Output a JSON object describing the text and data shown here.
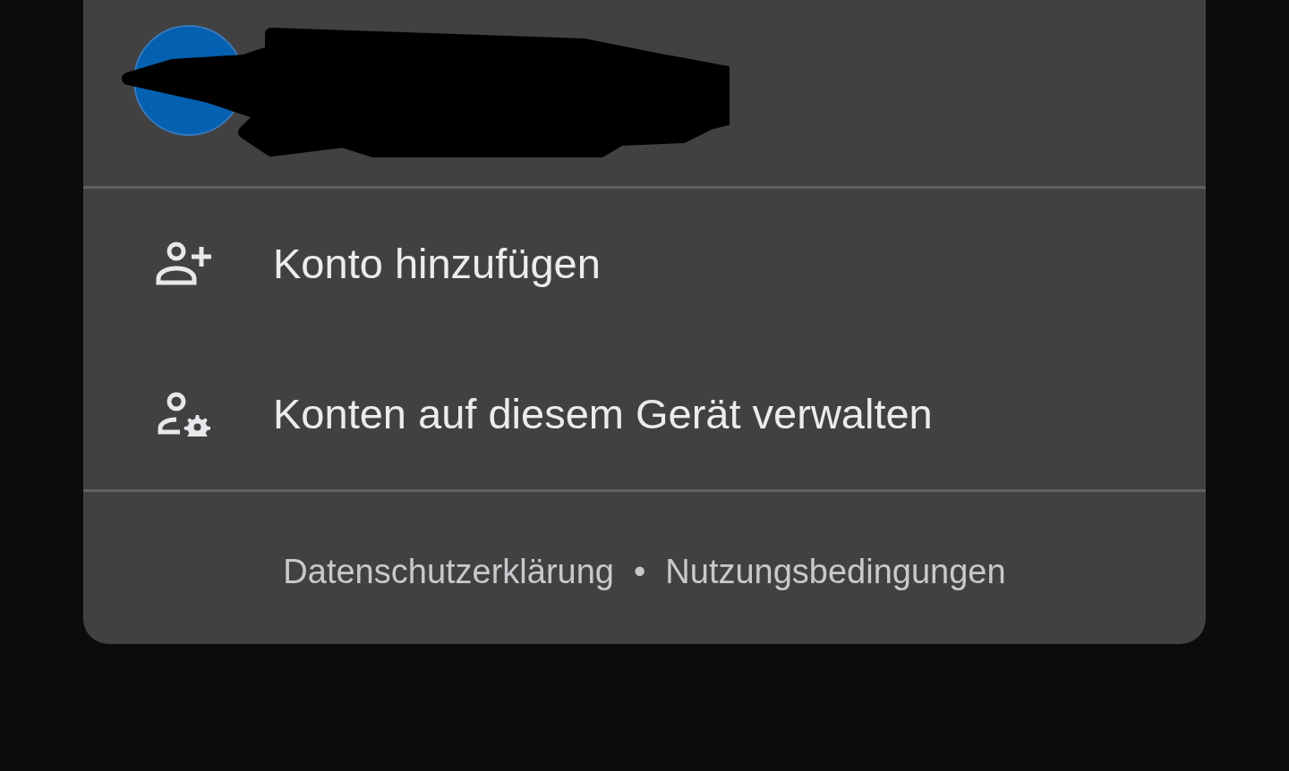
{
  "menu_items": [
    {
      "kind": "add",
      "label": "Konto hinzufügen"
    },
    {
      "kind": "manage",
      "label": "Konten auf diesem Gerät verwalten"
    }
  ],
  "footer_links": [
    "Datenschutzerklärung",
    "Nutzungsbedingungen"
  ],
  "footer_separator": "•"
}
